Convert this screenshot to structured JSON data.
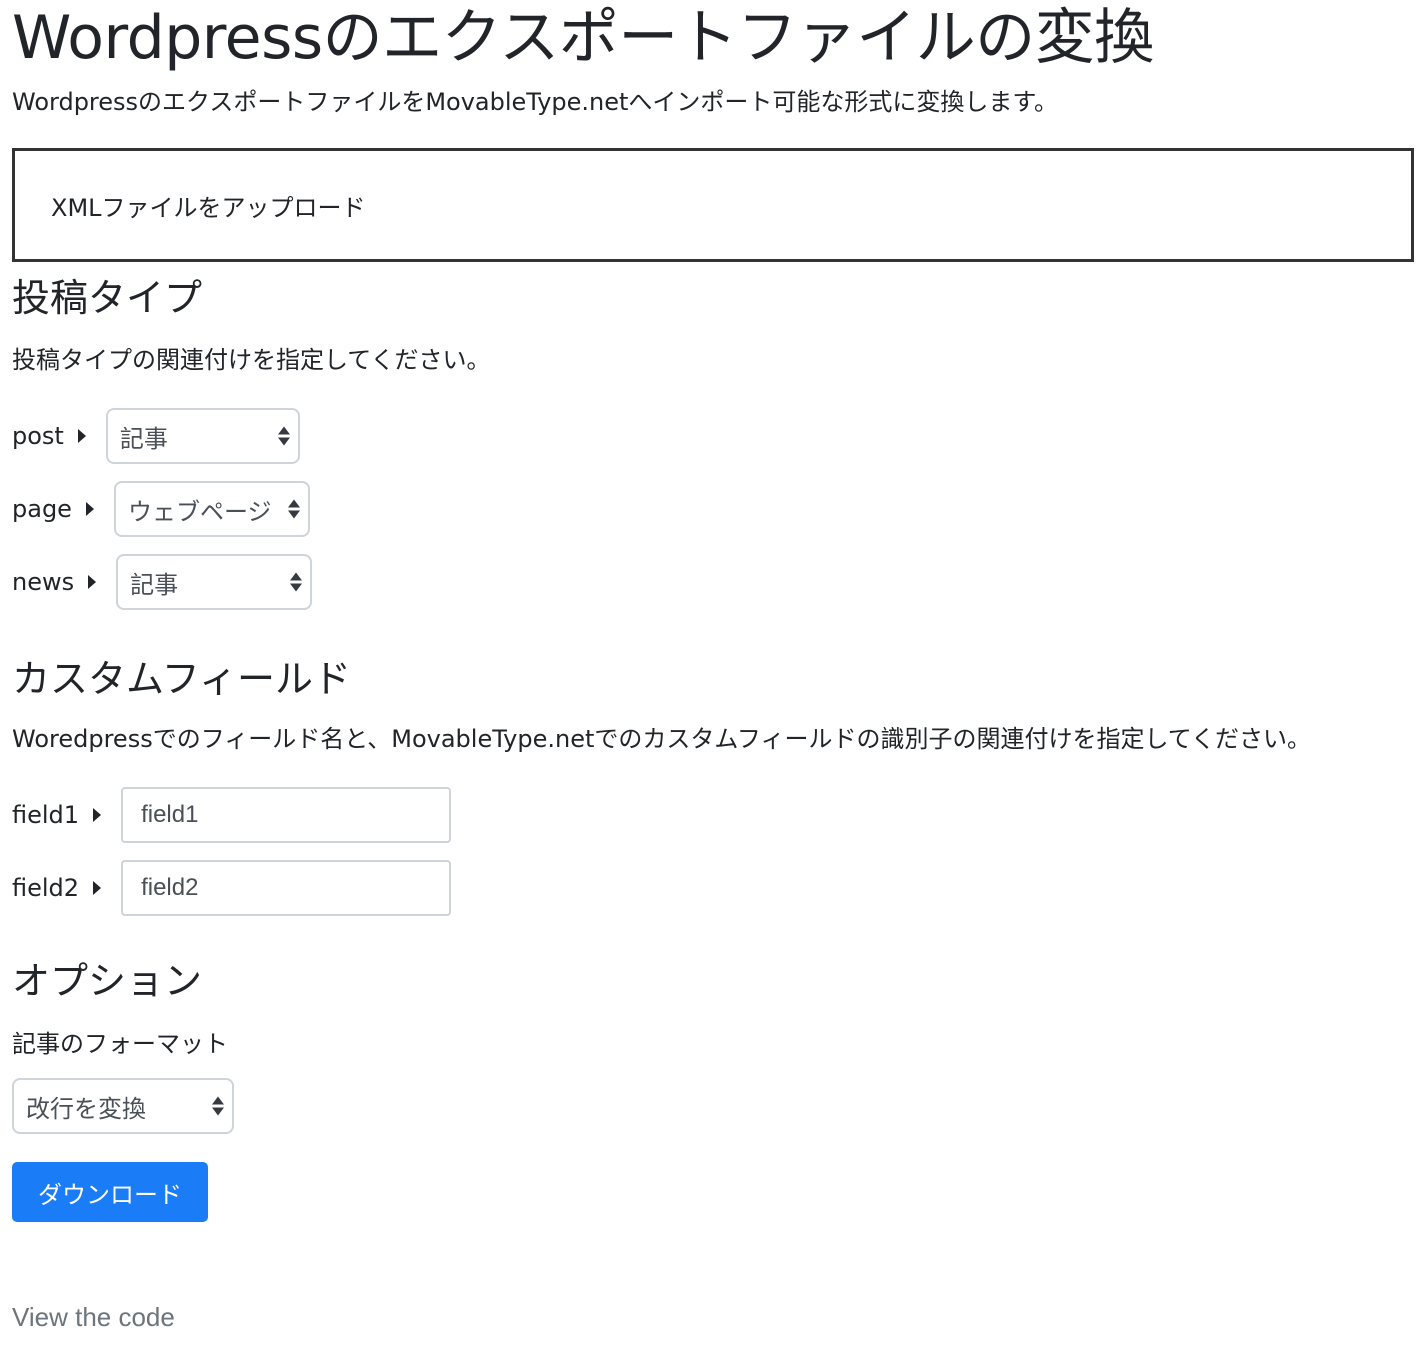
{
  "header": {
    "title": "Wordpressのエクスポートファイルの変換",
    "lead": "WordpressのエクスポートファイルをMovableType.netへインポート可能な形式に変換します。"
  },
  "upload": {
    "label": "XMLファイルをアップロード"
  },
  "post_types": {
    "heading": "投稿タイプ",
    "description": "投稿タイプの関連付けを指定してください。",
    "rows": [
      {
        "label": "post",
        "value": "記事"
      },
      {
        "label": "page",
        "value": "ウェブページ"
      },
      {
        "label": "news",
        "value": "記事"
      }
    ]
  },
  "custom_fields": {
    "heading": "カスタムフィールド",
    "description": "Woredpressでのフィールド名と、MovableType.netでのカスタムフィールドの識別子の関連付けを指定してください。",
    "rows": [
      {
        "label": "field1",
        "value": "field1"
      },
      {
        "label": "field2",
        "value": "field2"
      }
    ]
  },
  "options": {
    "heading": "オプション",
    "format_label": "記事のフォーマット",
    "format_value": "改行を変換"
  },
  "download_button": "ダウンロード",
  "footer_link": "View the code",
  "colors": {
    "primary": "#1a7cf6",
    "text": "#212529",
    "muted": "#6c757d"
  }
}
